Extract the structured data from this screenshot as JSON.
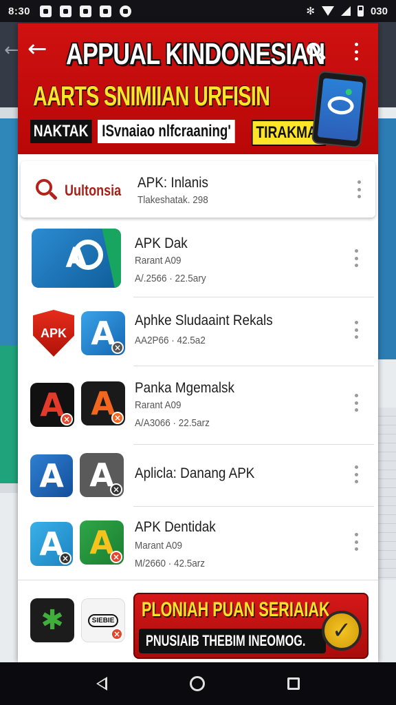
{
  "status_bar": {
    "time": "8:30",
    "battery": "030",
    "icons": [
      "notification-icon",
      "photo-icon",
      "check-icon",
      "music-icon",
      "chat-icon"
    ]
  },
  "header": {
    "title": "APPUAL KINDONESIAN",
    "subtitle": "AARTS SNIMIIAN URFISIN",
    "tag_black": "NAKTAK",
    "tag_white": "ISvnaiao nlfcraaning'",
    "tag_yellow": "TIRAKMA!",
    "background_color": "#c70d0d",
    "accent_color": "#ffe52a"
  },
  "search_result": {
    "query": "Uultonsia",
    "title": "APK: Inlanis",
    "meta": "Tlakeshatak. 298"
  },
  "apps": [
    {
      "title": "APK Dak",
      "developer": "Rarant A09",
      "meta": "A/.2566 · 22.5ary",
      "icon": "apk-logo-icon"
    },
    {
      "title": "Aphke Sludaaint Rekals",
      "developer": "",
      "meta": "AA2P66 · 42.5a2",
      "icon": "apk-shield-icon"
    },
    {
      "title": "Panka Mgemalsk",
      "developer": "Rarant A09",
      "meta": "A/A3066 · 22.5arz",
      "icon": "letter-a-icon"
    },
    {
      "title": "Aplicla: Danang APK",
      "developer": "",
      "meta": "",
      "icon": "letter-a-blue-icon"
    },
    {
      "title": "APK Dentidak",
      "developer": "Marant A09",
      "meta": "M/2660 · 42.5arz",
      "icon": "letter-a-yellow-icon"
    }
  ],
  "promo": {
    "line1": "PLONIAH PUAN SERIAIAK",
    "line2": "PNUSIAIB THEBIM INEOMOG.",
    "icon_left_label": "SIEBIE"
  },
  "nav": [
    "back",
    "home",
    "recents"
  ]
}
